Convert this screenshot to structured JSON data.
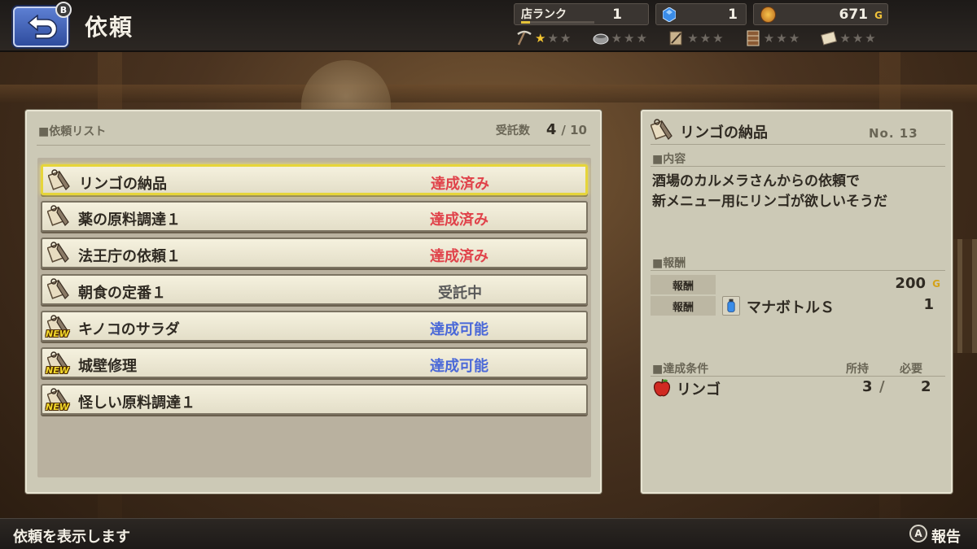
{
  "header": {
    "title": "依頼",
    "back_button_key": "B",
    "shop_rank": {
      "label": "店ランク",
      "value": "1",
      "progress": 0.12
    },
    "gems": "1",
    "gold": "671",
    "gold_unit": "G",
    "skills": [
      {
        "icon": "pickaxe-icon",
        "stars": 1
      },
      {
        "icon": "pot-icon",
        "stars": 0
      },
      {
        "icon": "scroll-tools-icon",
        "stars": 0
      },
      {
        "icon": "shelf-icon",
        "stars": 0
      },
      {
        "icon": "paper-icon",
        "stars": 0
      }
    ]
  },
  "list_panel": {
    "header": "■依頼リスト",
    "accepted_label": "受託数",
    "accepted_count": "4",
    "accepted_max": "/ 10",
    "items": [
      {
        "name": "リンゴの納品",
        "status": "達成済み",
        "status_color": "#e0424a",
        "is_new": false,
        "selected": true
      },
      {
        "name": "薬の原料調達１",
        "status": "達成済み",
        "status_color": "#e0424a",
        "is_new": false,
        "selected": false
      },
      {
        "name": "法王庁の依頼１",
        "status": "達成済み",
        "status_color": "#e0424a",
        "is_new": false,
        "selected": false
      },
      {
        "name": "朝食の定番１",
        "status": "受託中",
        "status_color": "#5a5a5a",
        "is_new": false,
        "selected": false
      },
      {
        "name": "キノコのサラダ",
        "status": "達成可能",
        "status_color": "#4a68d8",
        "is_new": true,
        "selected": false
      },
      {
        "name": "城壁修理",
        "status": "達成可能",
        "status_color": "#4a68d8",
        "is_new": true,
        "selected": false
      },
      {
        "name": "怪しい原料調達１",
        "status": "",
        "status_color": "#5a5a5a",
        "is_new": true,
        "selected": false
      }
    ],
    "new_badge": "NEW"
  },
  "detail_panel": {
    "title": "リンゴの納品",
    "number": "No. 13",
    "content_header": "■内容",
    "description_line1": "酒場のカルメラさんからの依頼で",
    "description_line2": "新メニュー用にリンゴが欲しいそうだ",
    "reward_header": "■報酬",
    "rewards": [
      {
        "tag": "報酬",
        "value": "200",
        "unit": "G"
      },
      {
        "tag": "報酬",
        "item": "マナボトルＳ",
        "qty": "1"
      }
    ],
    "condition_header": "■達成条件",
    "owned_label": "所持",
    "required_label": "必要",
    "condition": {
      "item": "リンゴ",
      "owned": "3",
      "slash": "/",
      "required": "2"
    }
  },
  "footer": {
    "message": "依頼を表示します",
    "action_key": "A",
    "action_label": "報告"
  }
}
